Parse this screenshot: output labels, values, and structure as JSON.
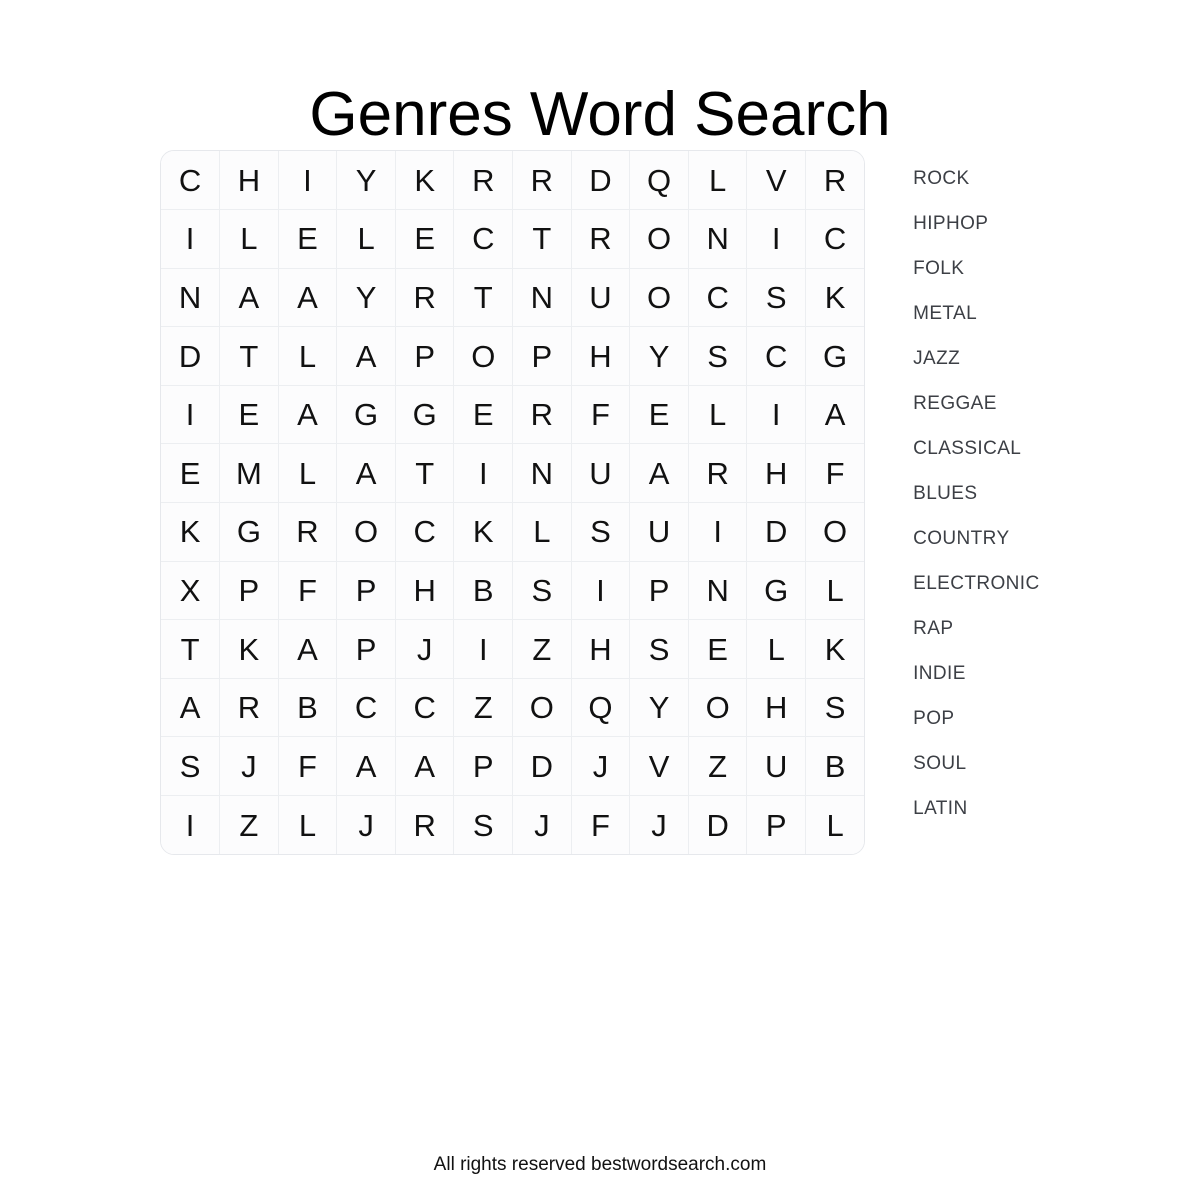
{
  "title": "Genres Word Search",
  "footer": "All rights reserved bestwordsearch.com",
  "grid": {
    "rows": 12,
    "cols": 12,
    "letters": [
      [
        "C",
        "H",
        "I",
        "Y",
        "K",
        "R",
        "R",
        "D",
        "Q",
        "L",
        "V",
        "R"
      ],
      [
        "I",
        "L",
        "E",
        "L",
        "E",
        "C",
        "T",
        "R",
        "O",
        "N",
        "I",
        "C"
      ],
      [
        "N",
        "A",
        "A",
        "Y",
        "R",
        "T",
        "N",
        "U",
        "O",
        "C",
        "S",
        "K"
      ],
      [
        "D",
        "T",
        "L",
        "A",
        "P",
        "O",
        "P",
        "H",
        "Y",
        "S",
        "C",
        "G"
      ],
      [
        "I",
        "E",
        "A",
        "G",
        "G",
        "E",
        "R",
        "F",
        "E",
        "L",
        "I",
        "A"
      ],
      [
        "E",
        "M",
        "L",
        "A",
        "T",
        "I",
        "N",
        "U",
        "A",
        "R",
        "H",
        "F"
      ],
      [
        "K",
        "G",
        "R",
        "O",
        "C",
        "K",
        "L",
        "S",
        "U",
        "I",
        "D",
        "O"
      ],
      [
        "X",
        "P",
        "F",
        "P",
        "H",
        "B",
        "S",
        "I",
        "P",
        "N",
        "G",
        "L"
      ],
      [
        "T",
        "K",
        "A",
        "P",
        "J",
        "I",
        "Z",
        "H",
        "S",
        "E",
        "L",
        "K"
      ],
      [
        "A",
        "R",
        "B",
        "C",
        "C",
        "Z",
        "O",
        "Q",
        "Y",
        "O",
        "H",
        "S"
      ],
      [
        "S",
        "J",
        "F",
        "A",
        "A",
        "P",
        "D",
        "J",
        "V",
        "Z",
        "U",
        "B"
      ],
      [
        "I",
        "Z",
        "L",
        "J",
        "R",
        "S",
        "J",
        "F",
        "J",
        "D",
        "P",
        "L"
      ]
    ]
  },
  "word_list": [
    "ROCK",
    "HIPHOP",
    "FOLK",
    "METAL",
    "JAZZ",
    "REGGAE",
    "CLASSICAL",
    "BLUES",
    "COUNTRY",
    "ELECTRONIC",
    "RAP",
    "INDIE",
    "POP",
    "SOUL",
    "LATIN"
  ],
  "colors": {
    "text": "#111111",
    "word_list_text": "#3c3f45",
    "grid_cell_bg": "#fcfcfd",
    "grid_border": "#eceef1",
    "card_border": "#e6e8ec",
    "page_bg": "#ffffff"
  }
}
